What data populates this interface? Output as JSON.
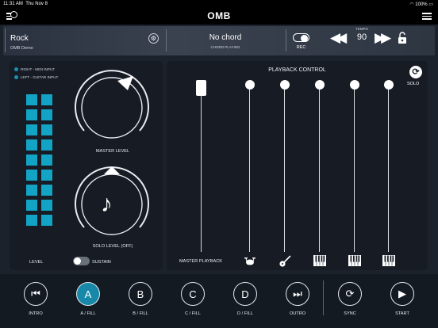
{
  "status_bar": {
    "time": "11:31 AM",
    "date": "Thu Nov 8",
    "battery": "100%"
  },
  "header": {
    "title": "OMB",
    "logo_icon": "omb-menu-logo-icon",
    "menu_icon": "hamburger-menu-icon"
  },
  "song": {
    "style": "Rock",
    "name": "OMB Demo",
    "settings_icon": "gear-icon"
  },
  "chord": {
    "value": "No chord",
    "caption": "CHORD PLAYING"
  },
  "rec": {
    "label": "REC",
    "on": true
  },
  "tempo": {
    "label": "TEMPO",
    "value": "90",
    "lock_icon": "lock-icon"
  },
  "inputs": {
    "right": "RIGHT - MIDI INPUT",
    "left": "LEFT - GUITAR INPUT"
  },
  "levels": {
    "master_label": "MASTER LEVEL",
    "solo_label": "SOLO LEVEL (OFF)",
    "level_label": "LEVEL",
    "sustain_label": "SUSTAIN",
    "sustain_on": false,
    "level_meter_rows": 9
  },
  "playback": {
    "title": "PLAYBACK CONTROL",
    "solo_label": "SOLO",
    "master_label": "MASTER PLAYBACK",
    "channels": [
      {
        "icon": "drums-icon",
        "level": 1.0
      },
      {
        "icon": "guitar-icon",
        "level": 1.0
      },
      {
        "icon": "piano-keys-icon",
        "level": 1.0
      },
      {
        "icon": "piano-keys-icon",
        "level": 1.0
      },
      {
        "icon": "piano-keys-icon",
        "level": 1.0
      }
    ],
    "master_level": 1.0
  },
  "controls": [
    {
      "id": "intro",
      "glyph": "⏮",
      "label": "INTRO",
      "active": false
    },
    {
      "id": "a",
      "glyph": "A",
      "label": "A / FILL",
      "active": true
    },
    {
      "id": "b",
      "glyph": "B",
      "label": "B / FILL",
      "active": false
    },
    {
      "id": "c",
      "glyph": "C",
      "label": "C / FILL",
      "active": false
    },
    {
      "id": "d",
      "glyph": "D",
      "label": "D / FILL",
      "active": false
    },
    {
      "id": "outro",
      "glyph": "⏭",
      "label": "OUTRO",
      "active": false
    },
    {
      "id": "sync",
      "glyph": "⟳",
      "label": "SYNC",
      "active": false
    },
    {
      "id": "start",
      "glyph": "▶",
      "label": "START",
      "active": false
    }
  ]
}
